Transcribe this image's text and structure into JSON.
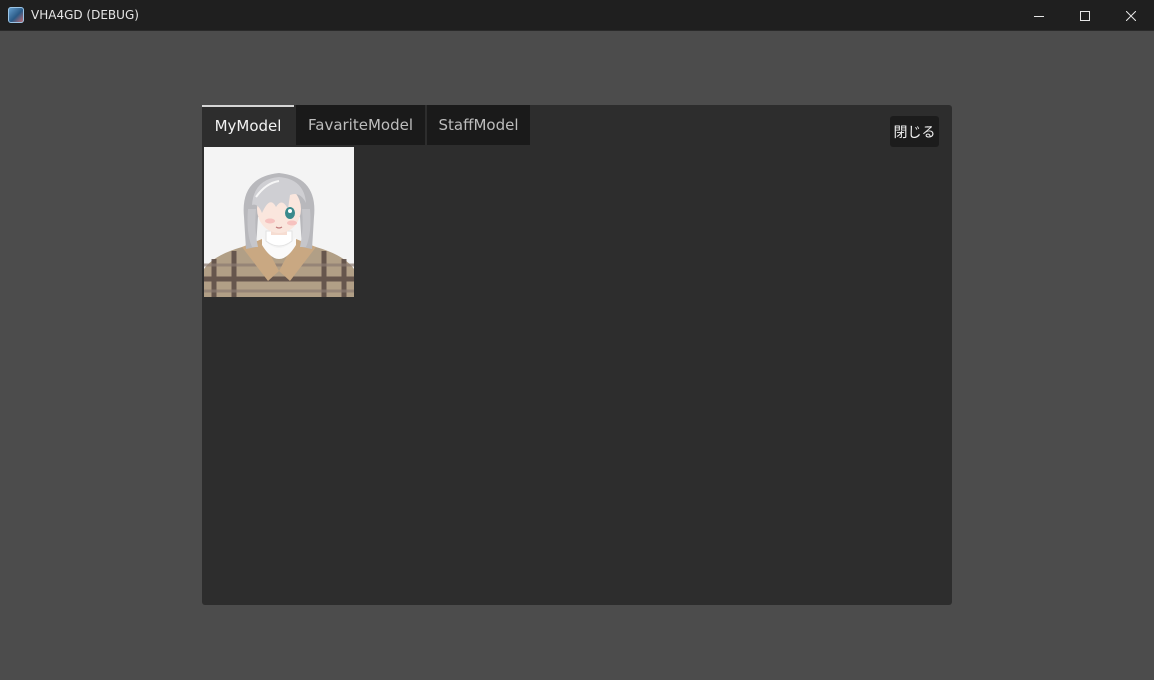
{
  "window": {
    "title": "VHA4GD (DEBUG)",
    "icon": "app-icon"
  },
  "panel": {
    "tabs": [
      {
        "label": "MyModel",
        "active": true
      },
      {
        "label": "FavariteModel",
        "active": false
      },
      {
        "label": "StaffModel",
        "active": false
      }
    ],
    "close_label": "閉じる",
    "models": [
      {
        "thumbnail": "avatar-thumbnail-silver-hair-girl-plaid-coat"
      }
    ]
  },
  "colors": {
    "background": "#4c4c4c",
    "panel": "#2d2d2d",
    "tab_inactive": "#1a1a1a",
    "titlebar": "#1f1f1f"
  }
}
